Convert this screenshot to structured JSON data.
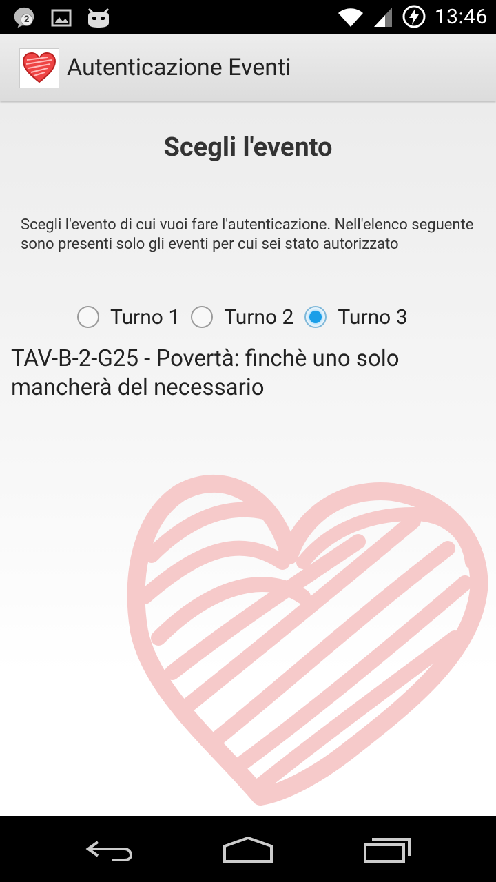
{
  "status_bar": {
    "time": "13:46",
    "notification_count": "2",
    "icons": [
      "chat-notification-icon",
      "picture-icon",
      "debug-bot-icon",
      "wifi-icon",
      "signal-icon",
      "battery-charging-icon"
    ]
  },
  "action_bar": {
    "title": "Autenticazione Eventi",
    "icon": "heart-app-icon"
  },
  "main": {
    "title": "Scegli l'evento",
    "description": "Scegli l'evento di cui vuoi fare l'autenticazione. Nell'elenco seguente sono presenti solo gli eventi per cui sei stato autorizzato",
    "shifts": [
      {
        "label": "Turno 1",
        "selected": false
      },
      {
        "label": "Turno 2",
        "selected": false
      },
      {
        "label": "Turno 3",
        "selected": true
      }
    ],
    "events": [
      "TAV-B-2-G25 - Povertà: finchè uno solo mancherà del necessario"
    ]
  },
  "colors": {
    "accent": "#1a9ee8",
    "heart_watermark": "#f7c9c9",
    "app_icon_heart": "#e03a3a"
  },
  "nav_bar": {
    "icons": [
      "back-icon",
      "home-icon",
      "recent-apps-icon"
    ]
  }
}
